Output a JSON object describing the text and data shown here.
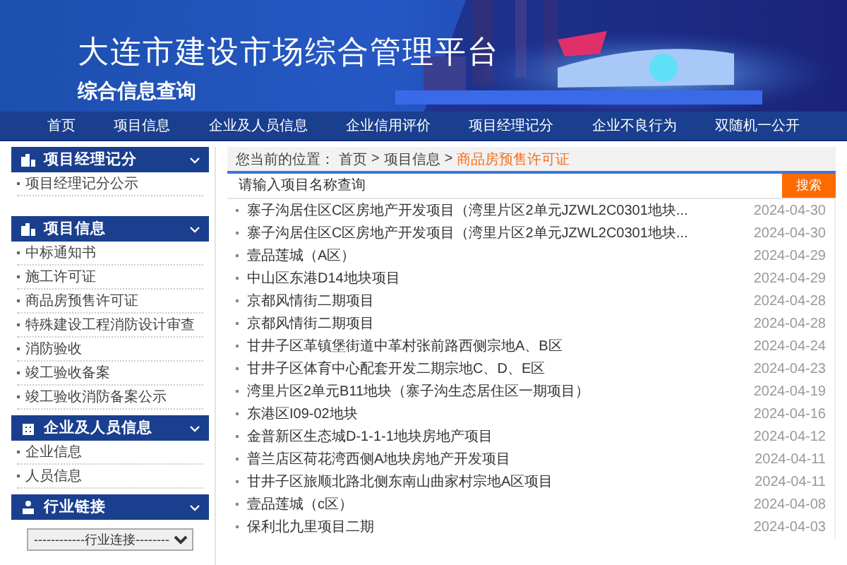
{
  "header": {
    "title": "大连市建设市场综合管理平台",
    "subtitle": "综合信息查询"
  },
  "nav": [
    {
      "label": "首页"
    },
    {
      "label": "项目信息"
    },
    {
      "label": "企业及人员信息"
    },
    {
      "label": "企业信用评价"
    },
    {
      "label": "项目经理记分"
    },
    {
      "label": "企业不良行为"
    },
    {
      "label": "双随机一公开"
    }
  ],
  "sidebar": [
    {
      "kind": "list",
      "title": "项目经理记分",
      "expanded": true,
      "items": [
        "项目经理记分公示"
      ]
    },
    {
      "kind": "list",
      "title": "项目信息",
      "expanded": true,
      "items": [
        "中标通知书",
        "施工许可证",
        "商品房预售许可证",
        "特殊建设工程消防设计审查",
        "消防验收",
        "竣工验收备案",
        "竣工验收消防备案公示"
      ]
    },
    {
      "kind": "list",
      "title": "企业及人员信息",
      "expanded": true,
      "items": [
        "企业信息",
        "人员信息"
      ]
    },
    {
      "kind": "select",
      "title": "行业链接",
      "expanded": true,
      "value": "------------行业连接--------"
    }
  ],
  "breadcrumb": {
    "label": "您当前的位置：",
    "crumbs": [
      {
        "kind": "link",
        "text": "首页"
      },
      {
        "kind": "sep",
        "text": ">"
      },
      {
        "kind": "link",
        "text": "项目信息"
      },
      {
        "kind": "sep",
        "text": ">"
      },
      {
        "kind": "current",
        "text": "商品房预售许可证"
      }
    ]
  },
  "search": {
    "placeholder": "请输入项目名称查询",
    "button": "搜索"
  },
  "rows": [
    {
      "title": "寨子沟居住区C区房地产开发项目（湾里片区2单元JZWL2C0301地块...",
      "date": "2024-04-30"
    },
    {
      "title": "寨子沟居住区C区房地产开发项目（湾里片区2单元JZWL2C0301地块...",
      "date": "2024-04-30"
    },
    {
      "title": "壹品莲城（A区）",
      "date": "2024-04-29"
    },
    {
      "title": "中山区东港D14地块项目",
      "date": "2024-04-29"
    },
    {
      "title": "京都风情街二期项目",
      "date": "2024-04-28"
    },
    {
      "title": "京都风情街二期项目",
      "date": "2024-04-28"
    },
    {
      "title": "甘井子区革镇堡街道中革村张前路西侧宗地A、B区",
      "date": "2024-04-24"
    },
    {
      "title": "甘井子区体育中心配套开发二期宗地C、D、E区",
      "date": "2024-04-23"
    },
    {
      "title": "湾里片区2单元B11地块（寨子沟生态居住区一期项目）",
      "date": "2024-04-19"
    },
    {
      "title": "东港区I09-02地块",
      "date": "2024-04-16"
    },
    {
      "title": "金普新区生态城D-1-1-1地块房地产项目",
      "date": "2024-04-12"
    },
    {
      "title": "普兰店区荷花湾西侧A地块房地产开发项目",
      "date": "2024-04-11"
    },
    {
      "title": "甘井子区旅顺北路北侧东南山曲家村宗地A区项目",
      "date": "2024-04-11"
    },
    {
      "title": "壹品莲城（c区）",
      "date": "2024-04-08"
    },
    {
      "title": "保利北九里项目二期",
      "date": "2024-04-03"
    }
  ]
}
